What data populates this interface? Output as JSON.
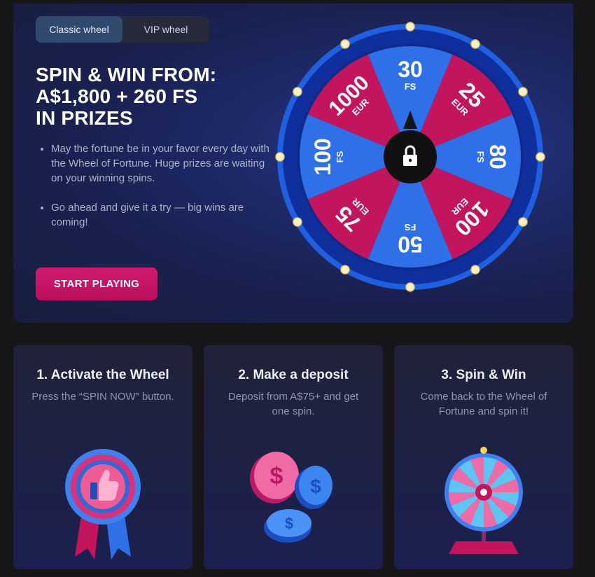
{
  "tabs": [
    {
      "label": "Classic wheel",
      "active": true
    },
    {
      "label": "VIP wheel",
      "active": false
    }
  ],
  "hero": {
    "title_lines": [
      "SPIN & WIN FROM:",
      "A$1,800 + 260 FS",
      "IN PRIZES"
    ],
    "bullets": [
      "May the fortune be in your favor every day with the Wheel of Fortune. Huge prizes are waiting on your winning spins.",
      "Go ahead and give it a try — big wins are coming!"
    ],
    "cta_label": "START PLAYING"
  },
  "wheel": {
    "segments": [
      {
        "value": "30",
        "unit": "FS",
        "color": "#2f6fe8"
      },
      {
        "value": "25",
        "unit": "EUR",
        "color": "#c2155e"
      },
      {
        "value": "80",
        "unit": "FS",
        "color": "#2f6fe8"
      },
      {
        "value": "100",
        "unit": "EUR",
        "color": "#c2155e"
      },
      {
        "value": "50",
        "unit": "FS",
        "color": "#2f6fe8"
      },
      {
        "value": "75",
        "unit": "EUR",
        "color": "#c2155e"
      },
      {
        "value": "100",
        "unit": "FS",
        "color": "#2f6fe8"
      },
      {
        "value": "1000",
        "unit": "EUR",
        "color": "#c2155e"
      }
    ],
    "center_icon": "lock-icon",
    "colors": {
      "rim": "#1f5fe0",
      "blue": "#2f6fe8",
      "pink": "#c2155e"
    }
  },
  "steps": [
    {
      "title": "1. Activate the Wheel",
      "desc": "Press the “SPIN NOW” button.",
      "icon": "thumbs-up-badge-icon"
    },
    {
      "title": "2. Make a deposit",
      "desc": "Deposit from A$75+ and get one spin.",
      "icon": "coins-icon"
    },
    {
      "title": "3. Spin & Win",
      "desc": "Come back to the Wheel of Fortune and spin it!",
      "icon": "fortune-wheel-icon"
    }
  ],
  "colors": {
    "accent": "#c8125f",
    "tab_active": "#2f4a6e",
    "background": "#161619"
  }
}
